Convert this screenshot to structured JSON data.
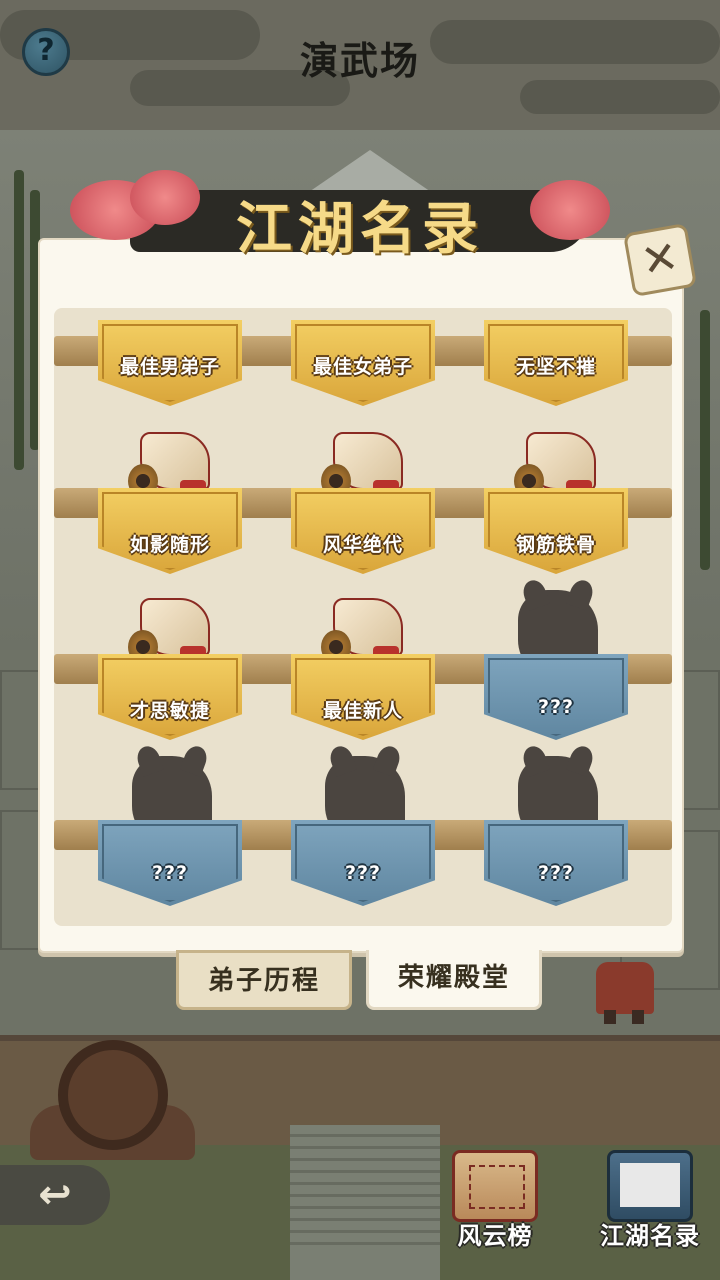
{
  "header": {
    "title": "演武场",
    "help_label": "?"
  },
  "dialog": {
    "title": "江湖名录",
    "close_label": "✕",
    "rows": [
      [
        {
          "label": "最佳男弟子",
          "unlocked": true
        },
        {
          "label": "最佳女弟子",
          "unlocked": true
        },
        {
          "label": "无坚不摧",
          "unlocked": true
        }
      ],
      [
        {
          "label": "如影随形",
          "unlocked": true
        },
        {
          "label": "风华绝代",
          "unlocked": true
        },
        {
          "label": "钢筋铁骨",
          "unlocked": true
        }
      ],
      [
        {
          "label": "才思敏捷",
          "unlocked": true
        },
        {
          "label": "最佳新人",
          "unlocked": true
        },
        {
          "label": "???",
          "unlocked": false
        }
      ],
      [
        {
          "label": "???",
          "unlocked": false
        },
        {
          "label": "???",
          "unlocked": false
        },
        {
          "label": "???",
          "unlocked": false
        }
      ]
    ],
    "tabs": [
      {
        "label": "弟子历程",
        "active": false
      },
      {
        "label": "荣耀殿堂",
        "active": true
      }
    ]
  },
  "bottom_bar": {
    "back_label": "↩",
    "buttons": [
      {
        "label": "风云榜",
        "icon": "scroll-icon"
      },
      {
        "label": "江湖名录",
        "icon": "book-icon"
      }
    ]
  },
  "colors": {
    "gold_plaque": "#e6b84a",
    "blue_plaque": "#6f96b0",
    "dialog_bg": "#fbf8ee",
    "title_gold": "#f6da88"
  }
}
